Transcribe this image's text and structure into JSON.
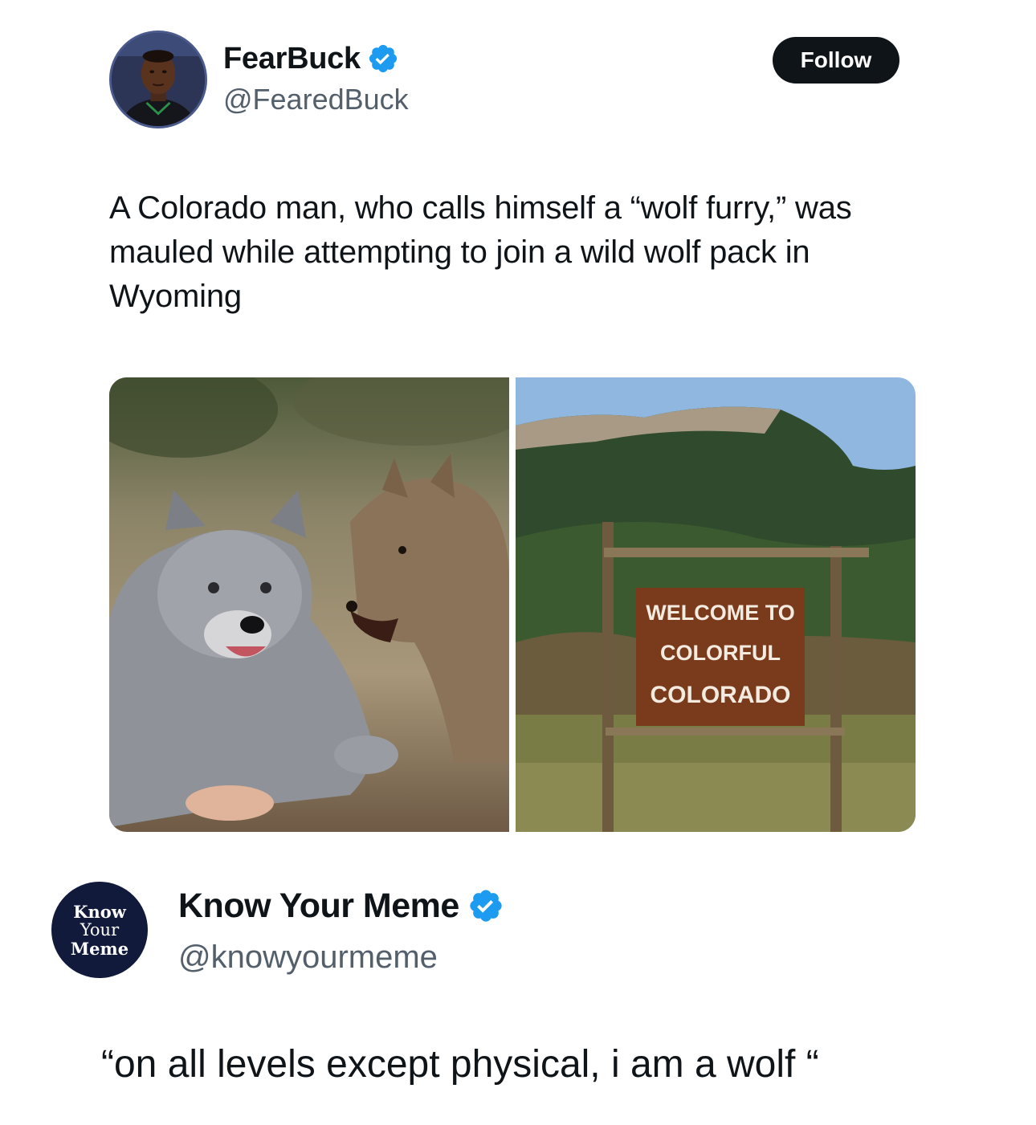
{
  "tweet": {
    "author": {
      "display_name": "FearBuck",
      "handle": "@FearedBuck",
      "verified": true,
      "avatar_icon": "profile-photo"
    },
    "follow_label": "Follow",
    "text": "A Colorado man, who calls himself a “wolf furry,” was mauled while attempting to join a wild wolf pack in Wyoming",
    "media": [
      {
        "description_icon": "wolf-furry-photo"
      },
      {
        "description_icon": "colorado-sign-photo",
        "sign_lines": [
          "WELCOME TO",
          "COLORFUL",
          "COLORADO"
        ]
      }
    ]
  },
  "reply": {
    "author": {
      "display_name": "Know Your Meme",
      "handle": "@knowyourmeme",
      "verified": true,
      "avatar_lines": [
        "Know",
        "Your",
        "Meme"
      ]
    },
    "text": "“on all levels except physical, i am a wolf “"
  },
  "colors": {
    "verified_blue": "#1d9bf0",
    "follow_bg": "#0f1419",
    "handle_gray": "#53606b",
    "kym_navy": "#121a3c"
  }
}
